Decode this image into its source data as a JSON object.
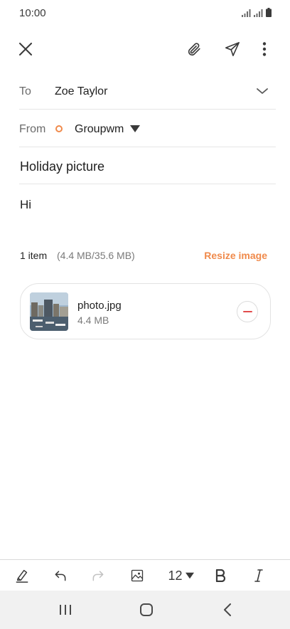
{
  "status_bar": {
    "time": "10:00",
    "icons": [
      "signal-icon",
      "signal-icon",
      "battery-icon"
    ]
  },
  "toolbar": {
    "icons": [
      "close-icon",
      "paperclip-icon",
      "send-icon",
      "more-vert-icon"
    ]
  },
  "compose": {
    "to_label": "To",
    "to_value": "Zoe Taylor",
    "from_label": "From",
    "from_value": "Groupwm",
    "subject": "Holiday picture",
    "body": "Hi"
  },
  "attachments": {
    "count_label": "1 item",
    "size_summary": "(4.4 MB/35.6 MB)",
    "resize_label": "Resize image",
    "items": [
      {
        "name": "photo.jpg",
        "size": "4.4 MB"
      }
    ]
  },
  "format_bar": {
    "font_size": "12",
    "icons": [
      "highlighter-icon",
      "undo-icon",
      "redo-icon",
      "insert-image-icon",
      "dropdown-icon",
      "bold-icon",
      "italic-icon"
    ]
  },
  "nav_bar": {
    "icons": [
      "recents-icon",
      "home-icon",
      "back-icon"
    ]
  },
  "colors": {
    "accent": "#f08a4b",
    "remove": "#e14b4b"
  }
}
